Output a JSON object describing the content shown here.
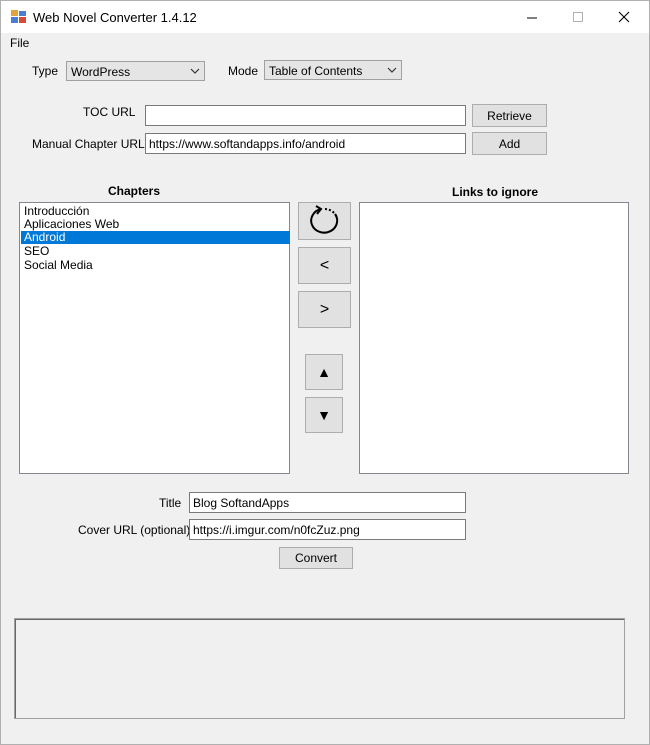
{
  "window": {
    "title": "Web Novel Converter 1.4.12"
  },
  "menu": {
    "file": "File"
  },
  "type": {
    "label": "Type",
    "selected": "WordPress"
  },
  "mode": {
    "label": "Mode",
    "selected": "Table of Contents"
  },
  "toc": {
    "label": "TOC URL",
    "value": "",
    "button": "Retrieve"
  },
  "manual": {
    "label": "Manual Chapter URL",
    "value": "https://www.softandapps.info/android",
    "button": "Add"
  },
  "chapters": {
    "header": "Chapters",
    "items": [
      "Introducción",
      "Aplicaciones Web",
      "Android",
      "SEO",
      "Social Media"
    ],
    "selected_index": 2
  },
  "links_to_ignore": {
    "header": "Links to ignore",
    "items": []
  },
  "move_buttons": {
    "left": "<",
    "right": ">",
    "up": "▲",
    "down": "▼"
  },
  "icons": {
    "refresh": "refresh-icon",
    "minimize": "minimize-icon",
    "maximize": "maximize-icon",
    "close": "close-icon",
    "app": "app-icon"
  },
  "book": {
    "title_label": "Title",
    "title_value": "Blog SoftandApps",
    "cover_label": "Cover URL (optional)",
    "cover_value": "https://i.imgur.com/n0fcZuz.png",
    "convert_button": "Convert"
  }
}
